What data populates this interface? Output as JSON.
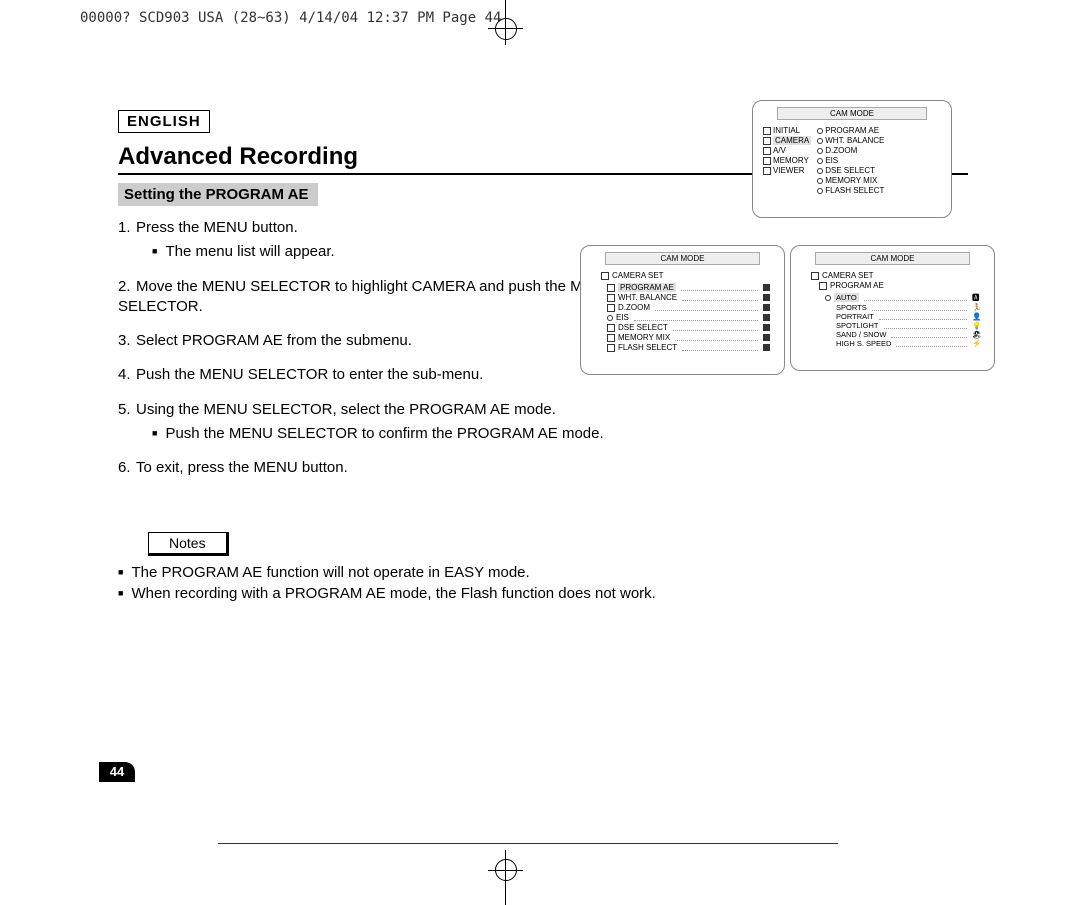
{
  "printHeader": "00000? SCD903 USA (28~63)  4/14/04 12:37 PM  Page 44",
  "language": "ENGLISH",
  "title": "Advanced Recording",
  "subtitle": "Setting the PROGRAM AE",
  "steps": {
    "s1": "Press the MENU button.",
    "s1a": "The menu list will appear.",
    "s2": "Move the MENU SELECTOR to highlight CAMERA and push the MENU SELECTOR.",
    "s3": "Select PROGRAM AE from the submenu.",
    "s4": "Push the MENU SELECTOR to enter the sub-menu.",
    "s5": "Using the MENU SELECTOR, select the PROGRAM AE mode.",
    "s5a": "Push the MENU SELECTOR to confirm the PROGRAM AE mode.",
    "s6": "To exit, press the MENU button."
  },
  "notesLabel": "Notes",
  "notes": {
    "n1": "The PROGRAM AE function will not operate in EASY mode.",
    "n2": "When recording with a PROGRAM AE mode, the Flash function does not work."
  },
  "pageNumber": "44",
  "screens": {
    "camMode": "CAM  MODE",
    "cameraSet": "CAMERA SET",
    "s1Left": [
      "INITIAL",
      "CAMERA",
      "A/V",
      "MEMORY",
      "VIEWER"
    ],
    "s1Right": [
      "PROGRAM AE",
      "WHT. BALANCE",
      "D.ZOOM",
      "EIS",
      "DSE SELECT",
      "MEMORY MIX",
      "FLASH SELECT"
    ],
    "s2Items": [
      "PROGRAM AE",
      "WHT. BALANCE",
      "D.ZOOM",
      "EIS",
      "DSE SELECT",
      "MEMORY MIX",
      "FLASH SELECT"
    ],
    "s3Group": "PROGRAM AE",
    "s3Items": [
      "AUTO",
      "SPORTS",
      "PORTRAIT",
      "SPOTLIGHT",
      "SAND / SNOW",
      "HIGH S. SPEED"
    ]
  }
}
